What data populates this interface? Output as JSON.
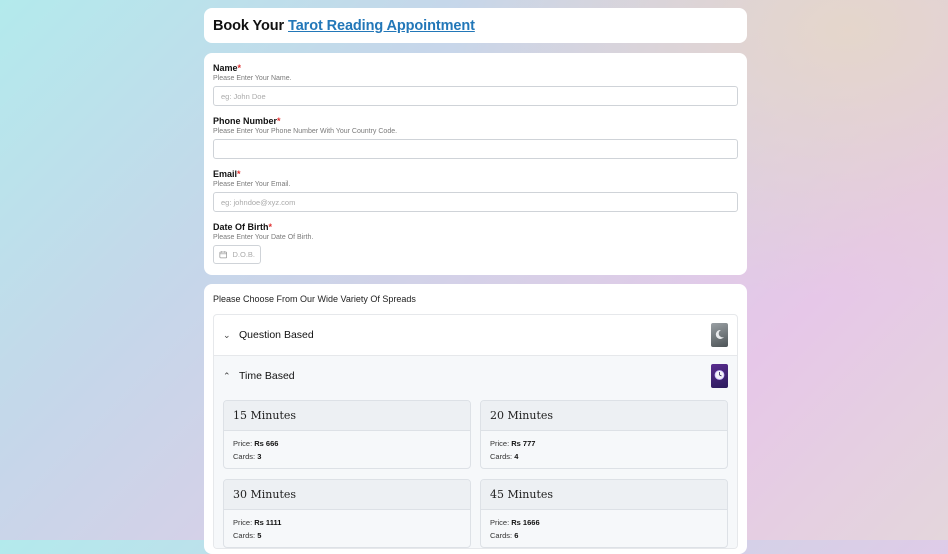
{
  "header": {
    "title_prefix": "Book Your",
    "title_link": "Tarot Reading Appointment"
  },
  "form": {
    "name": {
      "label": "Name",
      "required": "*",
      "help": "Please Enter Your Name.",
      "placeholder": "eg: John Doe"
    },
    "phone": {
      "label": "Phone Number",
      "required": "*",
      "help": "Please Enter Your Phone Number With Your Country Code.",
      "placeholder": ""
    },
    "email": {
      "label": "Email",
      "required": "*",
      "help": "Please Enter Your Email.",
      "placeholder": "eg: johndoe@xyz.com"
    },
    "dob": {
      "label": "Date Of Birth",
      "required": "*",
      "help": "Please Enter Your Date Of Birth.",
      "placeholder": "D.O.B."
    }
  },
  "spreads": {
    "title": "Please Choose From Our Wide Variety Of Spreads",
    "categories": [
      {
        "label": "Question Based",
        "state": "collapsed",
        "chevron": "⌄",
        "image": "moon-card-image"
      },
      {
        "label": "Time Based",
        "state": "expanded",
        "chevron": "⌃",
        "image": "clock-card-image"
      }
    ],
    "options": [
      {
        "title": "15 Minutes",
        "price_label": "Price:",
        "price": "Rs 666",
        "cards_label": "Cards:",
        "cards": "3"
      },
      {
        "title": "20 Minutes",
        "price_label": "Price:",
        "price": "Rs 777",
        "cards_label": "Cards:",
        "cards": "4"
      },
      {
        "title": "30 Minutes",
        "price_label": "Price:",
        "price": "Rs 1111",
        "cards_label": "Cards:",
        "cards": "5"
      },
      {
        "title": "45 Minutes",
        "price_label": "Price:",
        "price": "Rs 1666",
        "cards_label": "Cards:",
        "cards": "6"
      }
    ]
  },
  "colors": {
    "accent_link": "#2277b8",
    "required": "#e03131"
  }
}
